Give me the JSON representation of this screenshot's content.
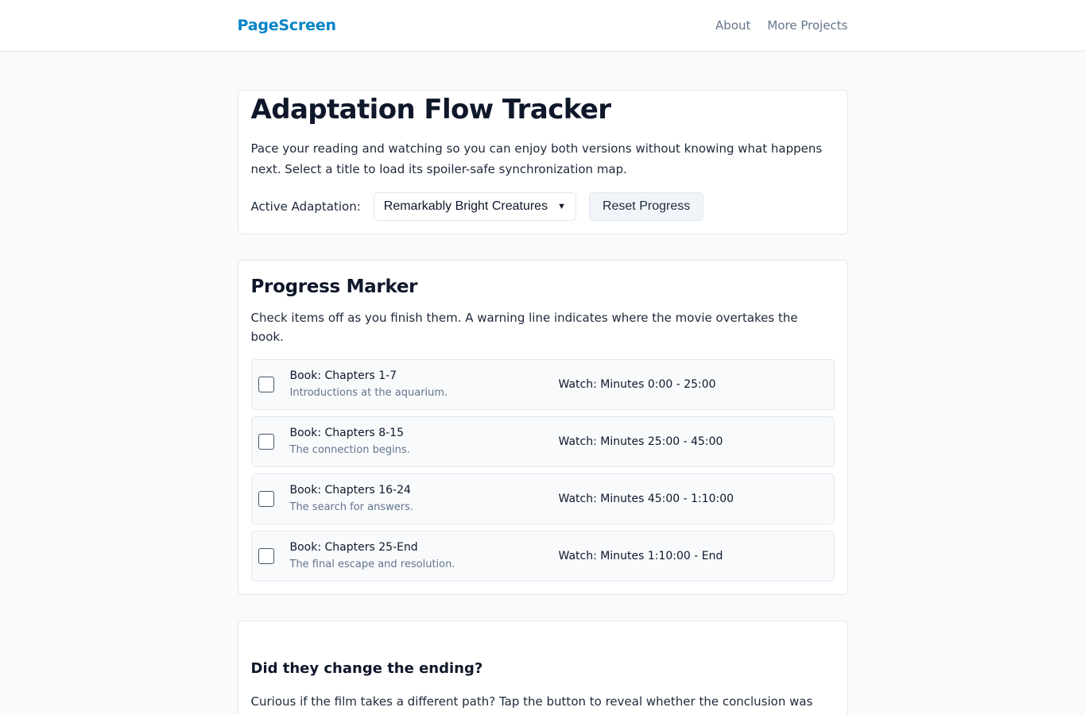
{
  "header": {
    "brand": "PageScreen",
    "nav": [
      "About",
      "More Projects"
    ]
  },
  "tracker": {
    "title": "Adaptation Flow Tracker",
    "intro": "Pace your reading and watching so you can enjoy both versions without knowing what happens next. Select a title to load its spoiler-safe synchronization map.",
    "active_label": "Active Adaptation:",
    "selected_adaptation": "Remarkably Bright Creatures",
    "reset_label": "Reset Progress"
  },
  "progress": {
    "title": "Progress Marker",
    "subtitle": "Check items off as you finish them. A warning line indicates where the movie overtakes the book.",
    "items": [
      {
        "book": "Book: Chapters 1-7",
        "desc": "Introductions at the aquarium.",
        "watch": "Watch: Minutes 0:00 - 25:00",
        "checked": false
      },
      {
        "book": "Book: Chapters 8-15",
        "desc": "The connection begins.",
        "watch": "Watch: Minutes 25:00 - 45:00",
        "checked": false
      },
      {
        "book": "Book: Chapters 16-24",
        "desc": "The search for answers.",
        "watch": "Watch: Minutes 45:00 - 1:10:00",
        "checked": false
      },
      {
        "book": "Book: Chapters 25-End",
        "desc": "The final escape and resolution.",
        "watch": "Watch: Minutes 1:10:00 - End",
        "checked": false
      }
    ]
  },
  "ending": {
    "title": "Did they change the ending?",
    "text": "Curious if the film takes a different path? Tap the button to reveal whether the conclusion was altered, left out, or kept exactly the same."
  },
  "colors": {
    "brand": "#0284c7",
    "background": "#f8fafc"
  }
}
